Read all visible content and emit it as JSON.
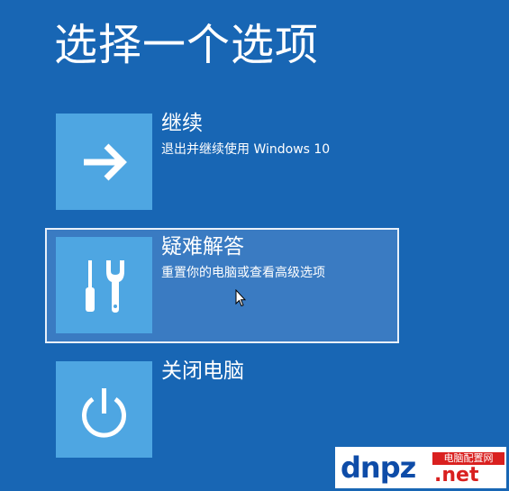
{
  "page": {
    "title": "选择一个选项"
  },
  "options": [
    {
      "label": "继续",
      "description": "退出并继续使用 Windows 10",
      "icon": "arrow-right-icon"
    },
    {
      "label": "疑难解答",
      "description": "重置你的电脑或查看高级选项",
      "icon": "tools-icon",
      "selected": true
    },
    {
      "label": "关闭电脑",
      "description": "",
      "icon": "power-icon"
    }
  ],
  "watermark": {
    "main": "dnpz",
    "badge": "电脑配置网",
    "suffix": ".net"
  },
  "colors": {
    "background": "#1866b4",
    "tile": "#4ea6e2",
    "selected_background": "#3a7bc2",
    "selected_border": "#e8f0fa",
    "watermark_blue": "#0e4ca8",
    "watermark_red": "#d9201f"
  }
}
